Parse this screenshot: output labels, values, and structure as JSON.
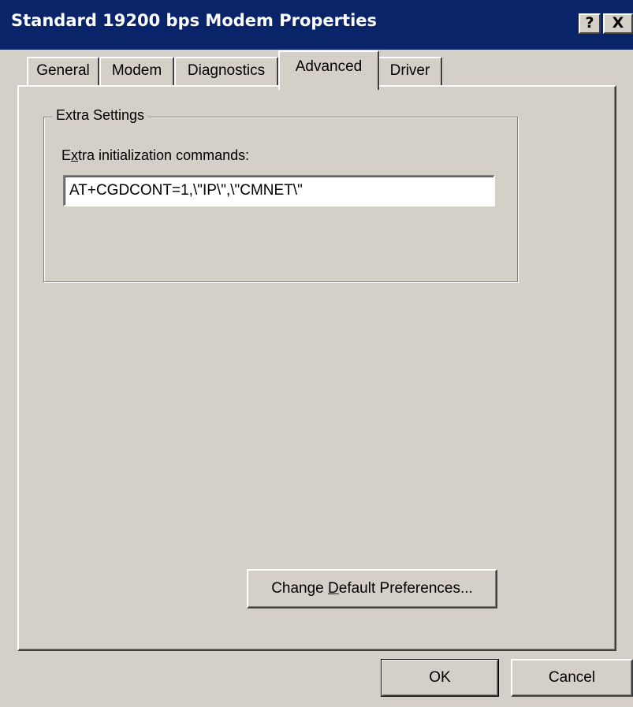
{
  "window": {
    "title": "Standard 19200 bps Modem Properties",
    "help_label": "?",
    "close_label": "X"
  },
  "tabs": [
    {
      "label": "General",
      "active": false
    },
    {
      "label": "Modem",
      "active": false
    },
    {
      "label": "Diagnostics",
      "active": false
    },
    {
      "label": "Advanced",
      "active": true
    },
    {
      "label": "Driver",
      "active": false
    }
  ],
  "extra_settings": {
    "group_title": "Extra Settings",
    "label_pre": "E",
    "label_accel": "x",
    "label_post": "tra initialization commands:",
    "init_commands_value": "AT+CGDCONT=1,\\\"IP\\\",\\\"CMNET\\\""
  },
  "buttons": {
    "change_default_pre": "Change ",
    "change_default_accel": "D",
    "change_default_post": "efault Preferences...",
    "ok_label": "OK",
    "cancel_label": "Cancel"
  },
  "colors": {
    "titlebar": "#0a246a",
    "face": "#d4d0c8"
  }
}
